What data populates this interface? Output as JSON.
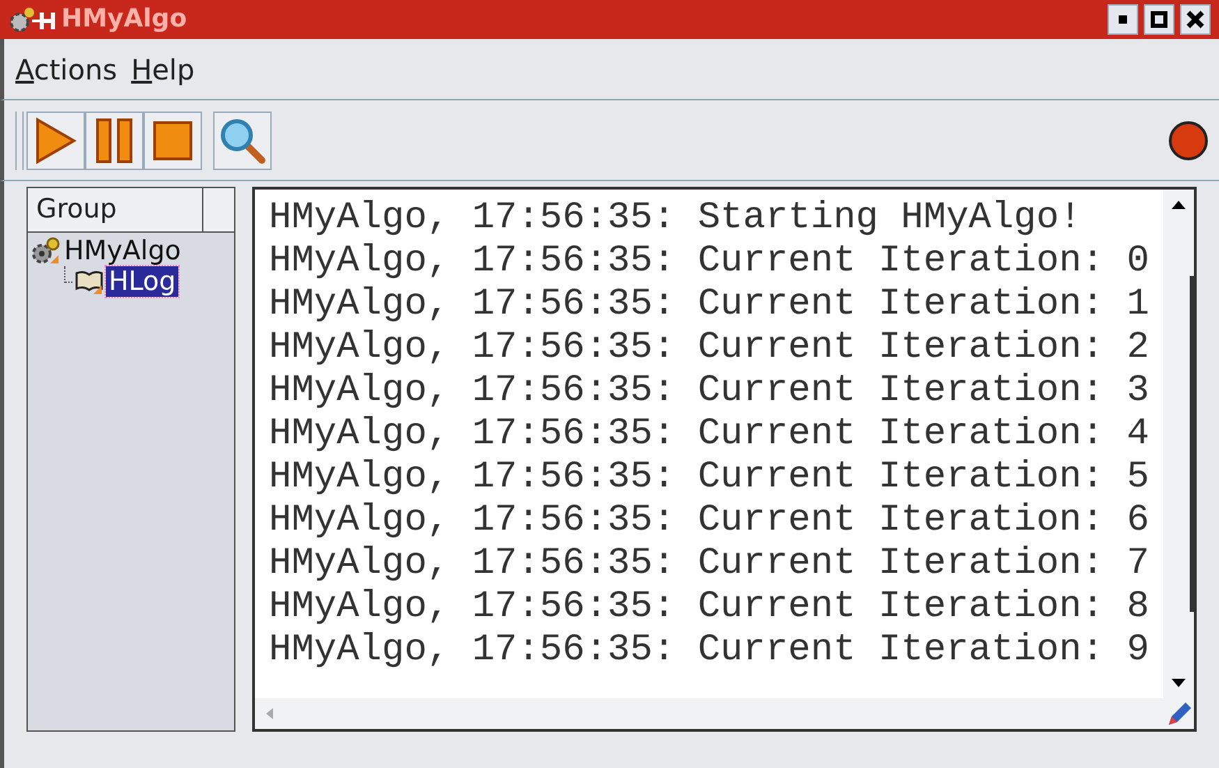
{
  "window": {
    "title": "HMyAlgo"
  },
  "menu": [
    {
      "label": "Actions"
    },
    {
      "label": "Help"
    }
  ],
  "toolbar": [
    {
      "kind": "play"
    },
    {
      "kind": "pause"
    },
    {
      "kind": "stop"
    },
    {
      "kind": "search"
    }
  ],
  "status_light": {
    "color": "#d83a10"
  },
  "tree": {
    "column": "Group",
    "items": [
      {
        "label": "HMyAlgo",
        "kind": "gear",
        "selected": false,
        "children": [
          {
            "label": "HLog",
            "kind": "book",
            "selected": true
          }
        ]
      }
    ]
  },
  "log": {
    "lines": [
      "HMyAlgo, 17:56:35: Starting HMyAlgo!",
      "HMyAlgo, 17:56:35: Current Iteration: 0",
      "HMyAlgo, 17:56:35: Current Iteration: 1",
      "HMyAlgo, 17:56:35: Current Iteration: 2",
      "HMyAlgo, 17:56:35: Current Iteration: 3",
      "HMyAlgo, 17:56:35: Current Iteration: 4",
      "HMyAlgo, 17:56:35: Current Iteration: 5",
      "HMyAlgo, 17:56:35: Current Iteration: 6",
      "HMyAlgo, 17:56:35: Current Iteration: 7",
      "HMyAlgo, 17:56:35: Current Iteration: 8",
      "HMyAlgo, 17:56:35: Current Iteration: 9"
    ]
  }
}
